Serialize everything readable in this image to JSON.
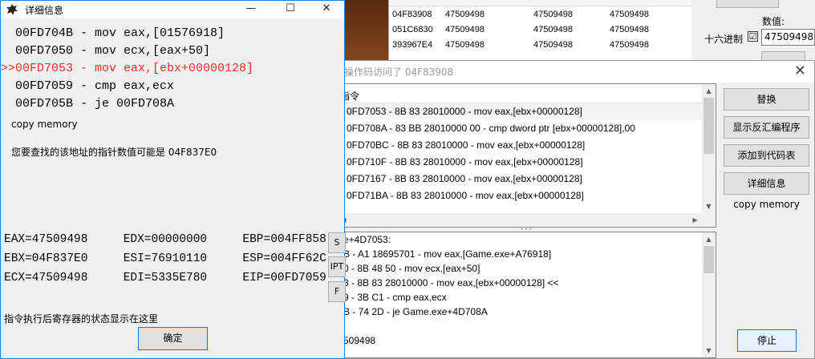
{
  "main": {
    "address_rows": [
      {
        "addr": "04F83908",
        "v1": "47509498",
        "v2": "47509498",
        "v3": "47509498"
      },
      {
        "addr": "051C6830",
        "v1": "47509498",
        "v2": "47509498",
        "v3": "47509498"
      },
      {
        "addr": "393967E4",
        "v1": "47509498",
        "v2": "47509498",
        "v3": "47509498"
      }
    ],
    "value_label": "数值:",
    "hex_label": "十六进制",
    "hex_checked": "☑",
    "value_input": "47509498"
  },
  "opcode_window": {
    "title": "操作码访问了 04F83908",
    "list_header": "指令",
    "instructions": [
      "0FD7053 - 8B 83 28010000  - mov eax,[ebx+00000128]",
      "0FD708A - 83 BB 28010000 00 - cmp dword ptr [ebx+00000128],00",
      "0FD70BC - 8B 83 28010000  - mov eax,[ebx+00000128]",
      "0FD710F - 8B 83 28010000  - mov eax,[ebx+00000128]",
      "0FD7167 - 8B 83 28010000  - mov eax,[ebx+00000128]",
      "0FD71BA - 8B 83 28010000  - mov eax,[ebx+00000128]"
    ],
    "disasm_lines": [
      "e+4D7053:",
      "B - A1 18695701 - mov eax,[Game.exe+A76918]",
      "0 - 8B 48 50  - mov ecx,[eax+50]",
      "3 - 8B 83 28010000  - mov eax,[ebx+00000128] <<",
      "9 - 3B C1  - cmp eax,ecx",
      "B - 74 2D - je Game.exe+4D708A",
      "",
      "509498"
    ],
    "buttons": {
      "replace": "替换",
      "show_disasm": "显示反汇编程序",
      "add_codelist": "添加到代码表",
      "details": "详细信息",
      "copy_memory": "copy memory",
      "stop": "停止"
    }
  },
  "detail_window": {
    "title": "详细信息",
    "asm_lines": [
      "  00FD704B - mov eax,[01576918]",
      "  00FD7050 - mov ecx,[eax+50]",
      ">>00FD7053 - mov eax,[ebx+00000128]",
      "  00FD7059 - cmp eax,ecx",
      "  00FD705B - je 00FD708A"
    ],
    "copy_memory": "copy memory",
    "pointer_text": "您要查找的该地址的指针数值可能是 04F837E0",
    "registers": [
      [
        "EAX=47509498",
        "EDX=00000000",
        "EBP=004FF858"
      ],
      [
        "EBX=04F837E0",
        "ESI=76910110",
        "ESP=004FF62C"
      ],
      [
        "ECX=47509498",
        "EDI=5335E780",
        "EIP=00FD7059"
      ]
    ],
    "side_buttons": [
      "S",
      "IPT",
      "F"
    ],
    "state_text": "指令执行后寄存器的状态显示在这里",
    "ok": "确定"
  },
  "colors": {
    "highlight": "#e23030",
    "accent": "#0078d7"
  }
}
